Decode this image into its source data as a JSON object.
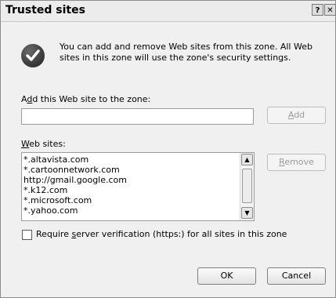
{
  "dialog": {
    "title": "Trusted sites",
    "help_glyph": "?",
    "close_glyph": "✕"
  },
  "intro": {
    "icon": "check-icon",
    "text": "You can add and remove Web sites from this zone. All Web sites in this zone will use the zone's security settings."
  },
  "add_section": {
    "label_prefix": "A",
    "label_mnemonic": "d",
    "label_rest": "d this Web site to the zone:",
    "input_value": "",
    "add_button_mnemonic": "A",
    "add_button_rest": "dd"
  },
  "websites": {
    "label_mnemonic": "W",
    "label_rest": "eb sites:",
    "items": [
      "*.altavista.com",
      "*.cartoonnetwork.com",
      "http://gmail.google.com",
      "*.k12.com",
      "*.microsoft.com",
      "*.yahoo.com"
    ],
    "remove_button_mnemonic": "R",
    "remove_button_rest": "emove"
  },
  "verification": {
    "checked": false,
    "label_prefix": "Require ",
    "label_mnemonic": "s",
    "label_rest": "erver verification (https:) for all sites in this zone"
  },
  "footer": {
    "ok_label": "OK",
    "cancel_label": "Cancel"
  }
}
